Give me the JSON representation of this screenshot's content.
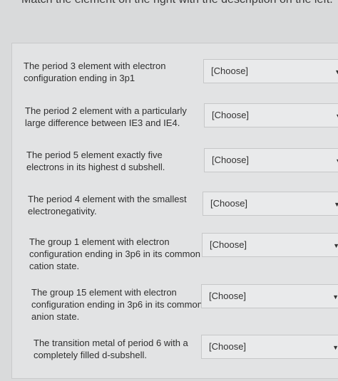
{
  "instructions": "Match the element on the right with the description on the left.",
  "items": [
    {
      "description": "The period 3 element with electron configuration ending in 3p1",
      "selected": "[Choose]"
    },
    {
      "description": "The period 2 element with a particularly large difference between IE3 and IE4.",
      "selected": "[Choose]"
    },
    {
      "description": "The period 5 element exactly five electrons in its highest d subshell.",
      "selected": "[Choose]"
    },
    {
      "description": "The period 4 element with the smallest electronegativity.",
      "selected": "[Choose]"
    },
    {
      "description": "The group 1 element with electron configuration ending in 3p6 in its common cation state.",
      "selected": "[Choose]"
    },
    {
      "description": "The group 15 element with electron configuration ending in 3p6 in its common anion state.",
      "selected": "[Choose]"
    },
    {
      "description": "The transition metal of period 6 with a completely filled d-subshell.",
      "selected": "[Choose]"
    }
  ],
  "icons": {
    "dropdown_caret": "caret-down-icon"
  }
}
